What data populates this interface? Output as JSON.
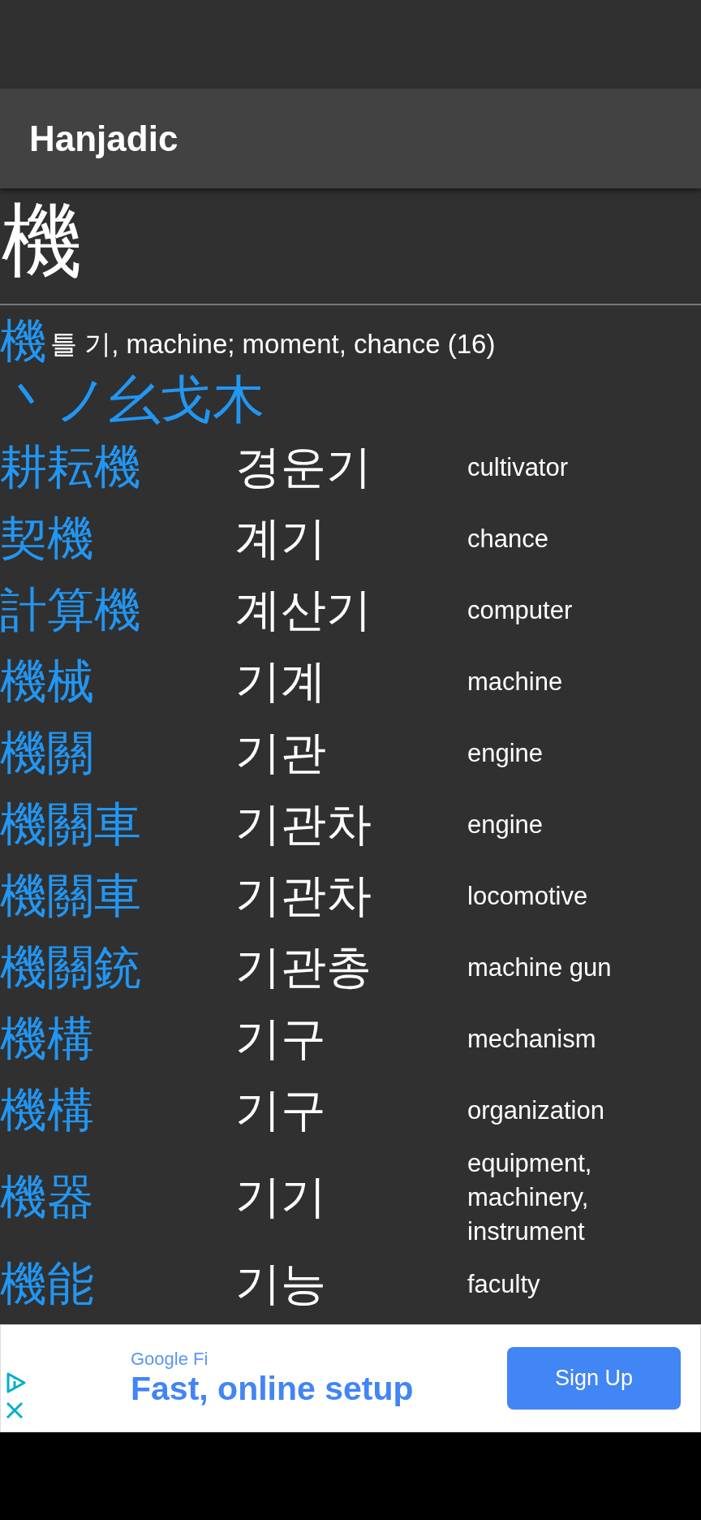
{
  "app_bar": {
    "title": "Hanjadic"
  },
  "character": "機",
  "summary": {
    "hanja": "機",
    "reading": "틀 기, machine; moment, chance (16)"
  },
  "radicals": "丶ノ幺戈木",
  "words": [
    {
      "hanja": "耕耘機",
      "hangul": "경운기",
      "meaning": "cultivator"
    },
    {
      "hanja": "契機",
      "hangul": "계기",
      "meaning": "chance"
    },
    {
      "hanja": "計算機",
      "hangul": "계산기",
      "meaning": "computer"
    },
    {
      "hanja": "機械",
      "hangul": "기계",
      "meaning": "machine"
    },
    {
      "hanja": "機關",
      "hangul": "기관",
      "meaning": "engine"
    },
    {
      "hanja": "機關車",
      "hangul": "기관차",
      "meaning": "engine"
    },
    {
      "hanja": "機關車",
      "hangul": "기관차",
      "meaning": "locomotive"
    },
    {
      "hanja": "機關銃",
      "hangul": "기관총",
      "meaning": "machine gun"
    },
    {
      "hanja": "機構",
      "hangul": "기구",
      "meaning": "mechanism"
    },
    {
      "hanja": "機構",
      "hangul": "기구",
      "meaning": "organization"
    },
    {
      "hanja": "機器",
      "hangul": "기기",
      "meaning": "equipment, machinery, instrument"
    },
    {
      "hanja": "機能",
      "hangul": "기능",
      "meaning": "faculty"
    }
  ],
  "ad": {
    "advertiser": "Google Fi",
    "headline": "Fast, online setup",
    "button": "Sign Up"
  }
}
